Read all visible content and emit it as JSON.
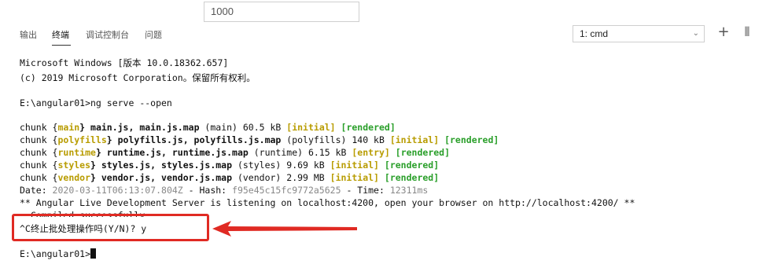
{
  "top_input": {
    "value": "1000"
  },
  "tabs": [
    {
      "label": "输出",
      "active": false
    },
    {
      "label": "终端",
      "active": true
    },
    {
      "label": "调试控制台",
      "active": false
    },
    {
      "label": "问题",
      "active": false
    }
  ],
  "terminal_selector": {
    "selected": "1: cmd"
  },
  "toolbar": {
    "add_label": "+",
    "split_label": "⫴"
  },
  "terminal": {
    "line1": "Microsoft Windows [版本 10.0.18362.657]",
    "line2": "(c) 2019 Microsoft Corporation。保留所有权利。",
    "prompt_cmd": "E:\\angular01>ng serve --open",
    "chunks": [
      {
        "prefix": "chunk {",
        "name": "main",
        "files": "} main.js, main.js.map",
        "kind": " (main) 60.5 kB ",
        "tag": "[initial]",
        "rendered": "[rendered]"
      },
      {
        "prefix": "chunk {",
        "name": "polyfills",
        "files": "} polyfills.js, polyfills.js.map",
        "kind": " (polyfills) 140 kB ",
        "tag": "[initial]",
        "rendered": "[rendered]"
      },
      {
        "prefix": "chunk {",
        "name": "runtime",
        "files": "} runtime.js, runtime.js.map",
        "kind": " (runtime) 6.15 kB ",
        "tag": "[entry]",
        "rendered": "[rendered]"
      },
      {
        "prefix": "chunk {",
        "name": "styles",
        "files": "} styles.js, styles.js.map",
        "kind": " (styles) 9.69 kB ",
        "tag": "[initial]",
        "rendered": "[rendered]"
      },
      {
        "prefix": "chunk {",
        "name": "vendor",
        "files": "} vendor.js, vendor.js.map",
        "kind": " (vendor) 2.99 MB ",
        "tag": "[initial]",
        "rendered": "[rendered]"
      }
    ],
    "date_prefix": "Date: ",
    "date_value": "2020-03-11T06:13:07.804Z",
    "hash_prefix": " - Hash: ",
    "hash_value": "f95e45c15fc9772a5625",
    "time_prefix": " - Time: ",
    "time_value": "12311ms",
    "server_line": "** Angular Live Development Server is listening on localhost:4200, open your browser on http://localhost:4200/ **",
    "compiled_line": ": Compiled successfully.",
    "terminate_line": "^C终止批处理操作吗(Y/N)? y",
    "final_prompt": "E:\\angular01>"
  },
  "colors": {
    "success_green": "#2a9f2a",
    "tag_yellow": "#b89c00",
    "annotation_red": "#e02a23"
  }
}
